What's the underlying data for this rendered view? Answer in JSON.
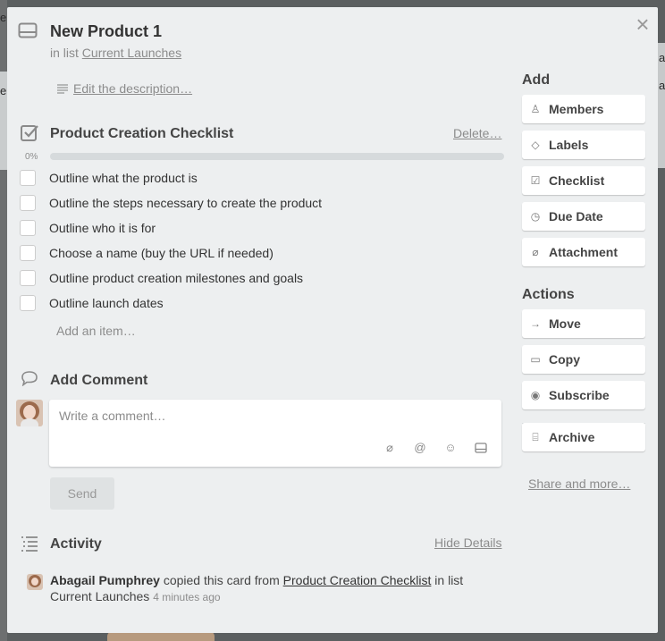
{
  "background": {
    "fragments": [
      "e",
      "e",
      "a",
      "a"
    ]
  },
  "card": {
    "title": "New Product 1",
    "in_list_prefix": "in list",
    "list_name": "Current Launches",
    "edit_description": "Edit the description…"
  },
  "checklist": {
    "title": "Product Creation Checklist",
    "delete_label": "Delete…",
    "percent_label": "0%",
    "progress": 0,
    "items": [
      {
        "text": "Outline what the product is",
        "checked": false
      },
      {
        "text": "Outline the steps necessary to create the product",
        "checked": false
      },
      {
        "text": "Outline who it is for",
        "checked": false
      },
      {
        "text": "Choose a name (buy the URL if needed)",
        "checked": false
      },
      {
        "text": "Outline product creation milestones and goals",
        "checked": false
      },
      {
        "text": "Outline launch dates",
        "checked": false
      }
    ],
    "add_item": "Add an item…"
  },
  "comment": {
    "title": "Add Comment",
    "placeholder": "Write a comment…",
    "send_label": "Send",
    "icons": [
      "attachment-icon",
      "mention-icon",
      "emoji-icon",
      "card-icon"
    ]
  },
  "activity": {
    "title": "Activity",
    "hide_details": "Hide Details",
    "entries": [
      {
        "user": "Abagail Pumphrey",
        "action": "copied this card from",
        "source": "Product Creation Checklist",
        "in_list": "in list",
        "list": "Current Launches",
        "time": "4 minutes ago"
      }
    ]
  },
  "sidebar": {
    "add_title": "Add",
    "add_buttons": [
      {
        "label": "Members",
        "icon": "person-icon"
      },
      {
        "label": "Labels",
        "icon": "tag-icon"
      },
      {
        "label": "Checklist",
        "icon": "checkbox-icon"
      },
      {
        "label": "Due Date",
        "icon": "clock-icon"
      },
      {
        "label": "Attachment",
        "icon": "paperclip-icon"
      }
    ],
    "actions_title": "Actions",
    "action_buttons": [
      {
        "label": "Move",
        "icon": "arrow-right-icon"
      },
      {
        "label": "Copy",
        "icon": "card-icon"
      },
      {
        "label": "Subscribe",
        "icon": "eye-icon"
      }
    ],
    "archive_label": "Archive",
    "share_label": "Share and more…"
  },
  "colors": {
    "modal_bg": "#edeff0",
    "overlay": "#5b5f60",
    "text": "#444444",
    "muted": "#8c8c8c"
  }
}
